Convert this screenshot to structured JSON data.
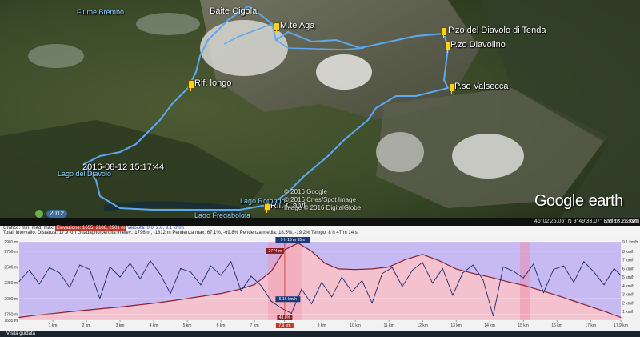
{
  "map": {
    "places": [
      {
        "name": "Baite Cigola",
        "style": "white"
      },
      {
        "name": "M.te Aga",
        "style": "white"
      },
      {
        "name": "P.zo del Diavolo di Tenda",
        "style": "white"
      },
      {
        "name": "P.zo Diavolino",
        "style": "white"
      },
      {
        "name": "P.so Valsecca",
        "style": "white"
      },
      {
        "name": "Rif. longo",
        "style": "white"
      },
      {
        "name": "Rif. Calvi",
        "style": "white"
      },
      {
        "name": "2016-08-12 15:17:44",
        "style": "white"
      },
      {
        "name": "Lago del Diavolo",
        "style": "blue"
      },
      {
        "name": "Lago Fregabolgia",
        "style": "blue"
      },
      {
        "name": "Lago Rotondo",
        "style": "blue"
      },
      {
        "name": "Fiume Brembo",
        "style": "blue"
      }
    ],
    "copyright": [
      "© 2016 Google",
      "© 2016 Cnes/Spot Image",
      "Image © 2016 DigitalGlobe"
    ],
    "year_badge": "2012",
    "logo": {
      "word1": "Google",
      "word2": "earth"
    },
    "status": {
      "coords": "46°02'25.05\" N  9°49'33.07\" E  elev 2136 m",
      "eye": "alt 13.28 km"
    }
  },
  "elevation_profile": {
    "stats_line1": {
      "lead": "Grafico: min, med, max:",
      "elev_label": "Elevazione: 1655, 2186, 2901 m",
      "speed_label": "Velocità: 0.0, 2.0, 9.1 km/h"
    },
    "stats_line2": "Totali intervallo: Distanza: 17.9 km   Guadagno/perdita in elev.: 1796 m, -1812 m   Pendenza max: 67.1%, -69.8%   Pendenza media: 18.5%, -19.2%   Tempo: 8 h 47 m 14 s",
    "marker_top": "9 h 13 m 35 s",
    "marker_value": "2774 m",
    "marker_speed": "5.16 km/h",
    "marker_pct": "48.6%",
    "marker_bottom": "7.9 km",
    "bottom_label": "Visita guidata"
  },
  "chart_data": {
    "type": "line",
    "x_unit": "km",
    "y_left_ticks": [
      "2901 m",
      "2750 m",
      "2500 m",
      "2250 m",
      "2000 m",
      "1750 m",
      "1655 m"
    ],
    "y_right_ticks": [
      "9.1 km/h",
      "8 km/h",
      "7 km/h",
      "6 km/h",
      "5 km/h",
      "4 km/h",
      "3 km/h",
      "2 km/h",
      "1 km/h"
    ],
    "x_ticks": [
      "1 km",
      "2 km",
      "3 km",
      "4 km",
      "5 km",
      "6 km",
      "7 km",
      "7.9 km",
      "9 km",
      "10 km",
      "11 km",
      "12 km",
      "13 km",
      "14 km",
      "15 km",
      "16 km",
      "17 km",
      "17.9 km"
    ],
    "ylim_elev": [
      1655,
      2901
    ],
    "ylim_speed": [
      0,
      9.1
    ],
    "xlim": [
      0,
      17.9
    ],
    "series": [
      {
        "name": "Elevazione",
        "color": "#8b1f2a",
        "x": [
          0,
          0.5,
          1,
          1.5,
          2,
          2.5,
          3,
          3.5,
          4,
          4.5,
          5,
          5.5,
          6,
          6.5,
          7,
          7.5,
          7.9,
          8.3,
          8.7,
          9.1,
          9.5,
          10,
          10.5,
          11,
          11.5,
          12,
          12.5,
          13,
          13.5,
          14,
          14.5,
          15,
          15.5,
          16,
          16.5,
          17,
          17.5,
          17.9
        ],
        "y": [
          1700,
          1735,
          1760,
          1790,
          1815,
          1840,
          1865,
          1895,
          1925,
          1960,
          2000,
          2040,
          2080,
          2140,
          2220,
          2430,
          2774,
          2880,
          2750,
          2560,
          2470,
          2460,
          2470,
          2500,
          2620,
          2700,
          2600,
          2470,
          2400,
          2340,
          2270,
          2210,
          2130,
          2050,
          1960,
          1870,
          1780,
          1700
        ]
      },
      {
        "name": "Velocità",
        "color": "#1b2a6b",
        "x": [
          0,
          0.3,
          0.6,
          0.9,
          1.2,
          1.5,
          1.8,
          2.1,
          2.4,
          2.7,
          3,
          3.3,
          3.6,
          3.9,
          4.2,
          4.5,
          4.8,
          5.1,
          5.4,
          5.7,
          6,
          6.3,
          6.6,
          6.9,
          7.2,
          7.5,
          7.8,
          8.1,
          8.4,
          8.7,
          9,
          9.3,
          9.6,
          9.9,
          10.2,
          10.5,
          10.8,
          11.1,
          11.4,
          11.7,
          12,
          12.3,
          12.6,
          12.9,
          13.2,
          13.5,
          13.8,
          14.1,
          14.4,
          14.7,
          15,
          15.3,
          15.6,
          15.9,
          16.2,
          16.5,
          16.8,
          17.1,
          17.4,
          17.7,
          17.9
        ],
        "y": [
          4.5,
          5.8,
          4.2,
          6.1,
          5.5,
          3.8,
          6.4,
          5.9,
          2.5,
          6.2,
          5.0,
          6.6,
          4.8,
          6.9,
          5.3,
          3.1,
          6.0,
          5.6,
          4.1,
          6.3,
          5.2,
          6.8,
          3.4,
          5.1,
          4.0,
          2.2,
          1.4,
          0.8,
          3.6,
          1.9,
          4.4,
          2.7,
          5.0,
          3.3,
          4.6,
          2.0,
          5.4,
          6.1,
          3.9,
          5.8,
          6.7,
          4.3,
          6.0,
          2.9,
          5.5,
          6.4,
          4.7,
          0.5,
          6.2,
          5.7,
          4.9,
          6.5,
          3.2,
          5.9,
          6.3,
          4.4,
          6.8,
          5.6,
          4.1,
          6.0,
          5.2
        ]
      }
    ]
  }
}
